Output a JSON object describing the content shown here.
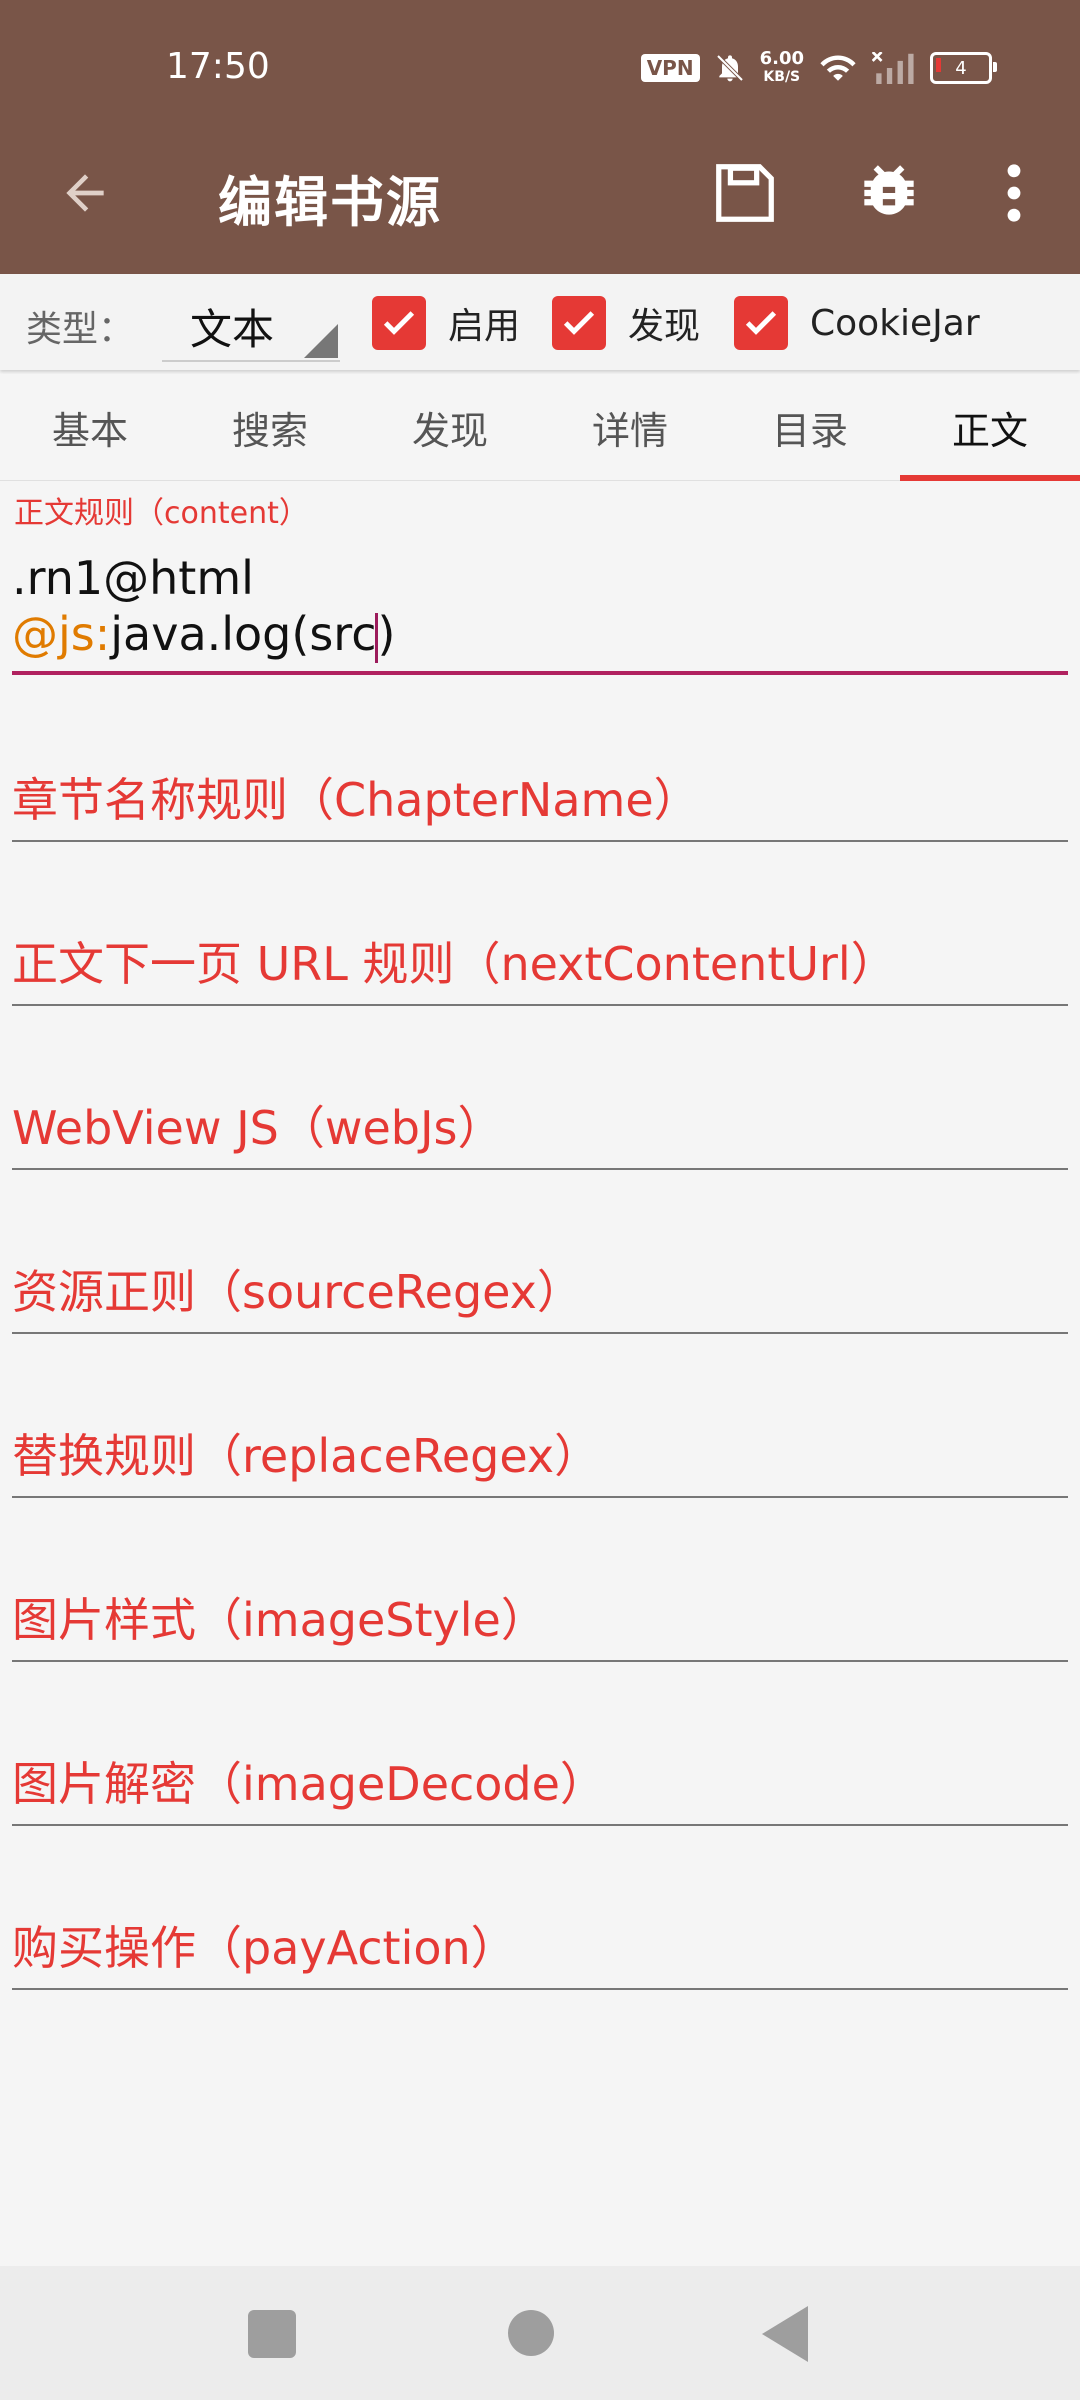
{
  "status_bar": {
    "time": "17:50",
    "vpn": "VPN",
    "speed_value": "6.00",
    "speed_unit": "KB/S",
    "battery": "4"
  },
  "toolbar": {
    "title": "编辑书源",
    "icons": [
      "arrow-back-icon",
      "save-icon",
      "bug-icon",
      "more-vert-icon"
    ]
  },
  "options": {
    "type_label": "类型：",
    "type_value": "文本",
    "checkboxes": [
      {
        "label": "启用",
        "checked": true
      },
      {
        "label": "发现",
        "checked": true
      },
      {
        "label": "CookieJar",
        "checked": true
      }
    ],
    "accent_color": "#e53935"
  },
  "tabs": [
    {
      "label": "基本",
      "active": false
    },
    {
      "label": "搜索",
      "active": false
    },
    {
      "label": "发现",
      "active": false
    },
    {
      "label": "详情",
      "active": false
    },
    {
      "label": "目录",
      "active": false
    },
    {
      "label": "正文",
      "active": true
    }
  ],
  "content_field": {
    "label": "正文规则（content）",
    "line1": ".rn1@html",
    "js_prefix": "@js:",
    "line2_before_cursor": "java.log(src",
    "line2_after_cursor": ")"
  },
  "rule_fields": [
    {
      "label": "章节名称规则（ChapterName）"
    },
    {
      "label": "正文下一页 URL 规则（nextContentUrl）"
    },
    {
      "label": "WebView JS（webJs）"
    },
    {
      "label": "资源正则（sourceRegex）"
    },
    {
      "label": "替换规则（replaceRegex）"
    },
    {
      "label": "图片样式（imageStyle）"
    },
    {
      "label": "图片解密（imageDecode）"
    },
    {
      "label": "购买操作（payAction）"
    }
  ],
  "colors": {
    "appbar": "#795548",
    "accent": "#e53935",
    "cursor_line": "#b0215f",
    "js_keyword": "#e07b00"
  }
}
